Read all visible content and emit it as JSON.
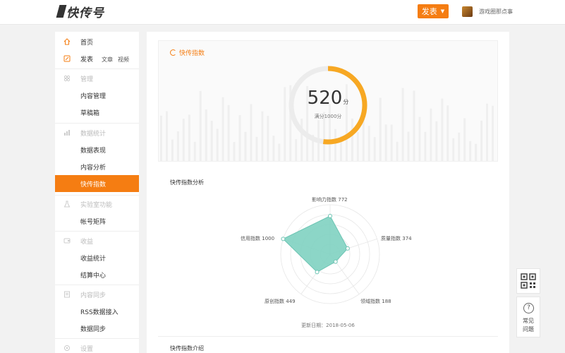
{
  "header": {
    "logo_text": "快传号",
    "publish_label": "发表",
    "username": "游戏圈那点事"
  },
  "sidebar": {
    "items": [
      {
        "label": "首页",
        "icon": "home-icon"
      },
      {
        "label": "发表",
        "icon": "edit-icon",
        "sub": [
          "文章",
          "视频"
        ]
      },
      {
        "label": "管理",
        "icon": "grid-icon"
      },
      {
        "label": "内容管理"
      },
      {
        "label": "草稿箱"
      },
      {
        "label": "数据统计",
        "icon": "bar-chart-icon"
      },
      {
        "label": "数据表现"
      },
      {
        "label": "内容分析"
      },
      {
        "label": "快传指数"
      },
      {
        "label": "实验室功能",
        "icon": "flask-icon"
      },
      {
        "label": "帐号矩阵"
      },
      {
        "label": "收益",
        "icon": "wallet-icon"
      },
      {
        "label": "收益统计"
      },
      {
        "label": "结算中心"
      },
      {
        "label": "内容同步",
        "icon": "sync-icon"
      },
      {
        "label": "RSS数据接入"
      },
      {
        "label": "数据同步"
      },
      {
        "label": "设置",
        "icon": "gear-icon"
      }
    ]
  },
  "main": {
    "panel_title": "快传指数",
    "score": "520",
    "score_unit": "分",
    "score_max_label": "满分1000分",
    "score_fraction": 0.52,
    "analysis_title": "快传指数分析",
    "update_date": "更新日期：2018-05-06",
    "intro_title": "快传指数介绍"
  },
  "radar": {
    "max": 1000,
    "axes": [
      {
        "name": "影响力指数",
        "value": 772
      },
      {
        "name": "质量指数",
        "value": 374
      },
      {
        "name": "领域指数",
        "value": 188
      },
      {
        "name": "原创指数",
        "value": 449
      },
      {
        "name": "信用指数",
        "value": 1000
      }
    ],
    "fill_color": "#7fd1c1"
  },
  "tools": {
    "help_label_1": "常见",
    "help_label_2": "问题"
  },
  "colors": {
    "accent": "#f57d12",
    "gauge": "#f7a823"
  }
}
